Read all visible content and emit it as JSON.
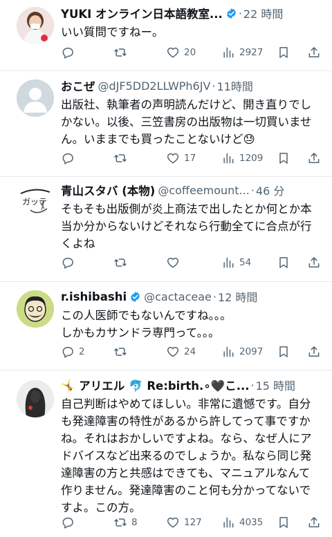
{
  "colors": {
    "text": "#0f1419",
    "muted": "#536471",
    "verified": "#1d9bf0",
    "divider": "#e6e9ec"
  },
  "tweets": [
    {
      "name": "YUKI オンライン日本語教室...",
      "verified": true,
      "handle": "",
      "time": "22 時間",
      "text": "いい質問ですねー。",
      "reply": "",
      "retweet": "",
      "like": "20",
      "views": "2927"
    },
    {
      "name": "おこぜ",
      "verified": false,
      "handle": "@dJF5DD2LLWPh6JV",
      "time": "11時間",
      "text": "出版社、執筆者の声明読んだけど、開き直りでしかない。以後、三笠書房の出版物は一切買いません。いままでも買ったことないけど😓",
      "reply": "",
      "retweet": "",
      "like": "17",
      "views": "1209"
    },
    {
      "name": "青山スタバ (本物)",
      "verified": false,
      "handle": "@coffeemount...",
      "time": "46 分",
      "text": "そもそも出版側が炎上商法で出したとか何とか本当か分からないけどそれなら行動全てに合点が行くよね",
      "reply": "",
      "retweet": "",
      "like": "",
      "views": "54"
    },
    {
      "name": "r.ishibashi",
      "verified": true,
      "handle": "@cactaceae",
      "time": "12 時間",
      "text": "この人医師でもないんですね。。。\nしかもカサンドラ専門って。。。",
      "reply": "2",
      "retweet": "",
      "like": "24",
      "views": "2097"
    },
    {
      "name": "🤸 アリエル 🐬 Re:birth.∘🖤こ...",
      "verified": false,
      "handle": "",
      "time": "15 時間",
      "text": "自己判断はやめてほしい。非常に遺憾です。自分も発達障害の特性があるから許してって事ですかね。それはおかしいですよね。なら、なぜ人にアドバイスなど出来るのでしょうか。私なら同じ発達障害の方と共感はできても、マニュアルなんて作りません。発達障害のこと何も分かってないですよ。この方。",
      "reply": "",
      "retweet": "8",
      "like": "127",
      "views": "4035"
    }
  ]
}
